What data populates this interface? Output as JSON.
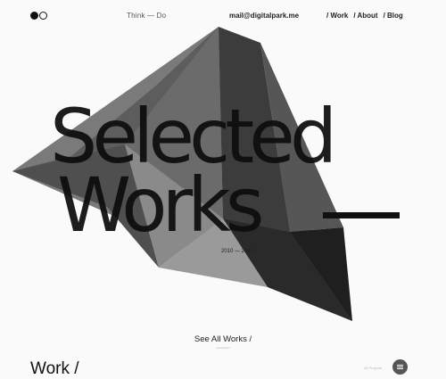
{
  "header": {
    "tagline": "Think — Do",
    "email": "mail@digitalpark.me",
    "nav": [
      {
        "label": "/ Work"
      },
      {
        "label": "/ About"
      },
      {
        "label": "/ Blog"
      }
    ]
  },
  "hero": {
    "line1": "Selected",
    "line2": "Works",
    "years": "2010 — 2013"
  },
  "see_all": {
    "label": "See All Works /",
    "sub": "scroll down"
  },
  "work_section": {
    "title": "Work /",
    "filter_label": "All Projects"
  },
  "colors": {
    "background": "#fafafa",
    "text": "#111111",
    "filter_button": "#555555"
  },
  "icons": {
    "logo": "two-dots-logo-icon",
    "filter": "menu-lines-icon"
  }
}
